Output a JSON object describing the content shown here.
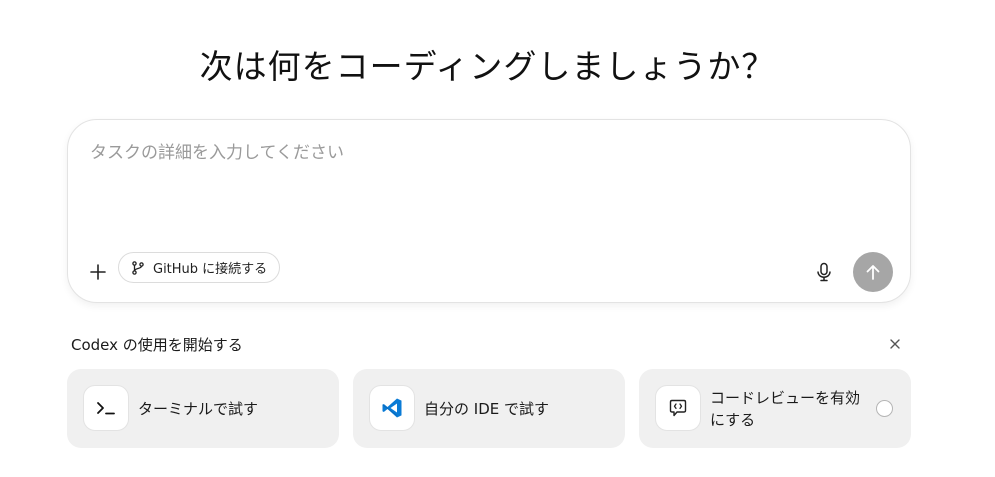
{
  "header": {
    "title": "次は何をコーディングしましょうか？"
  },
  "composer": {
    "placeholder": "タスクの詳細を入力してください",
    "value": "",
    "github_button_label": "GitHub に接続する"
  },
  "getting_started": {
    "title": "Codex の使用を開始する",
    "cards": [
      {
        "label": "ターミナルで試す",
        "icon": "terminal-icon"
      },
      {
        "label": "自分の IDE で試す",
        "icon": "vscode-icon"
      },
      {
        "label": "コードレビューを有効にする",
        "icon": "code-review-icon",
        "has_radio": true
      }
    ]
  },
  "colors": {
    "send_button": "#a6a6a6",
    "card_bg": "#f0f0f0",
    "vscode_blue": "#0a7bd6"
  }
}
